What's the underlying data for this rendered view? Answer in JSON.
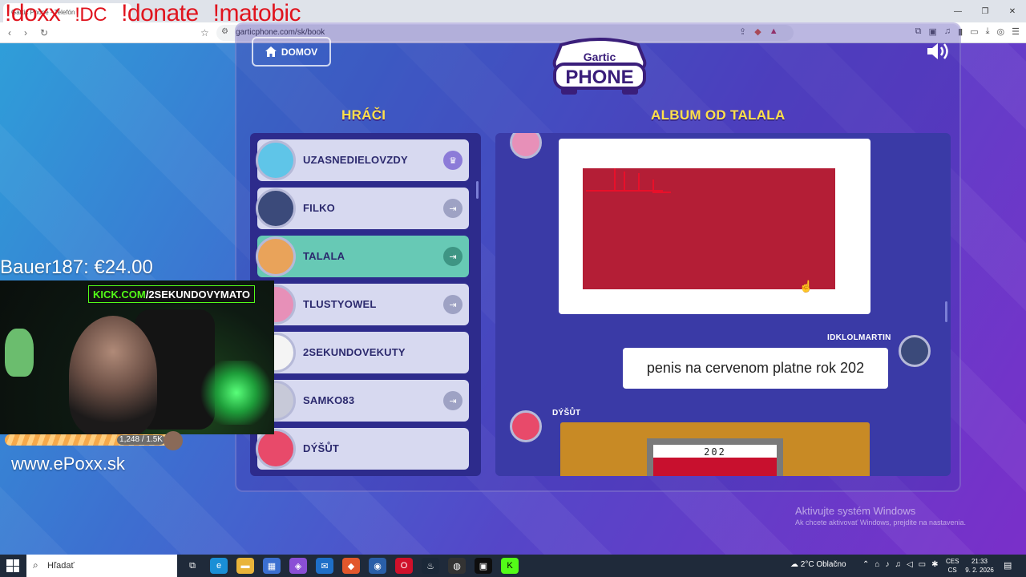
{
  "browser": {
    "tab_title": "Gartic Phone - Telefón",
    "url": "garticphone.com/sk/book",
    "window_controls": [
      "—",
      "❐",
      "✕"
    ]
  },
  "game": {
    "home_button": "DOMOV",
    "logo_top": "Gartic",
    "logo_bottom": "PHONE",
    "players_heading": "HRÁČI",
    "album_heading": "ALBUM OD TALALA",
    "players": [
      {
        "name": "UZASNEDIELOVZDY",
        "badge": "crown-icon",
        "active": false
      },
      {
        "name": "FILKO",
        "badge": "exit-icon",
        "active": false
      },
      {
        "name": "TALALA",
        "badge": "exit-icon",
        "active": true
      },
      {
        "name": "TLUSTYOWEL",
        "badge": "exit-icon",
        "active": false
      },
      {
        "name": "2SEKUNDOVEKUTY",
        "badge": "",
        "active": false
      },
      {
        "name": "SAMKO83",
        "badge": "exit-icon",
        "active": false
      },
      {
        "name": "DÝŠŮT",
        "badge": "",
        "active": false
      }
    ],
    "album": {
      "guess_author": "IDKLOLMARTIN",
      "guess_text": "penis na cervenom platne rok 202",
      "drawing2_author": "DÝŠŮT",
      "drawing2_sign_text": "202"
    }
  },
  "stream_overlay": {
    "commands": [
      "!doxx",
      "!DC",
      "!donate",
      "!matobic"
    ],
    "donation": "Bauer187: €24.00",
    "kick_label_green": "KICK.COM",
    "kick_label_white": "/2SEKUNDOVYMATO",
    "sub_count": "1,248 / 1.5K",
    "website": "www.ePoxx.sk"
  },
  "windows_activation": {
    "title": "Aktivujte systém Windows",
    "subtitle": "Ak chcete aktivovať Windows, prejdite na nastavenia."
  },
  "taskbar": {
    "search_placeholder": "Hľadať",
    "weather": "2°C  Oblačno",
    "lang_top": "CES",
    "lang_bottom": "CS",
    "time": "21:33",
    "date": "9. 2. 2026"
  },
  "colors": {
    "accent_heading": "#ffe04a",
    "active_player": "#67c9b5",
    "drawing_red": "#b41e36",
    "overlay_red": "#e0141e",
    "kick_green": "#53fc18"
  }
}
